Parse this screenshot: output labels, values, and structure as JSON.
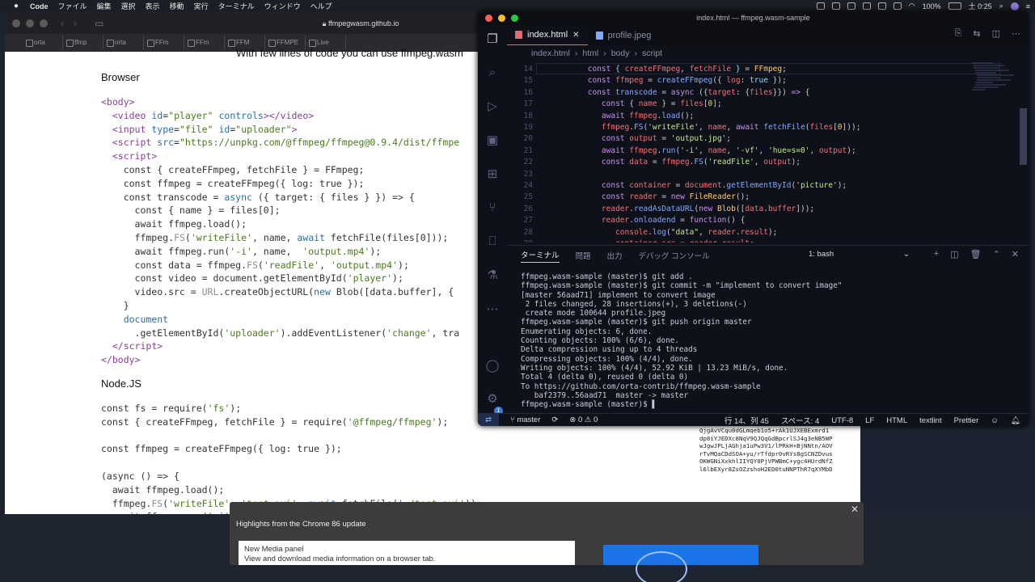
{
  "menubar": {
    "app": "Code",
    "items": [
      "ファイル",
      "編集",
      "選択",
      "表示",
      "移動",
      "実行",
      "ターミナル",
      "ウィンドウ",
      "ヘルプ"
    ],
    "battery": "100%",
    "clock": "土 0:25"
  },
  "chrome": {
    "url": "ffmpegwasm.github.io",
    "tabs": [
      "orta",
      "ffmp",
      "orta",
      "FFm",
      "FFm",
      "FFM",
      "FFMPE",
      "Live"
    ],
    "partial_heading": "With few lines of code you can use ffmpeg.wasm",
    "browser_heading": "Browser",
    "nodejs_heading": "Node.JS"
  },
  "vscode": {
    "title": "index.html — ffmpeg.wasm-sample",
    "tabs": [
      {
        "label": "index.html",
        "close": "✕"
      },
      {
        "label": "profile.jpeg"
      }
    ],
    "breadcrumbs": [
      "index.html",
      "html",
      "body",
      "script"
    ],
    "line_numbers": "14\n15\n16\n17\n18\n19\n20\n21\n22\n23\n24\n25\n26\n27\n28\n29",
    "panel_tabs": [
      "ターミナル",
      "問題",
      "出力",
      "デバッグ コンソール"
    ],
    "terminal_select": "1: bash",
    "terminal": "ffmpeg.wasm-sample (master)$ git add .\nffmpeg.wasm-sample (master)$ git commit -m \"implement to convert image\"\n[master 56aad71] implement to convert image\n 2 files changed, 28 insertions(+), 3 deletions(-)\n create mode 100644 profile.jpeg\nffmpeg.wasm-sample (master)$ git push origin master\nEnumerating objects: 6, done.\nCounting objects: 100% (6/6), done.\nDelta compression using up to 4 threads\nCompressing objects: 100% (4/4), done.\nWriting objects: 100% (4/4), 52.92 KiB | 13.23 MiB/s, done.\nTotal 4 (delta 0), reused 0 (delta 0)\nTo https://github.com/orta-contrib/ffmpeg.wasm-sample\n   baf2379..56aad71  master -> master\nffmpeg.wasm-sample (master)$ ▌",
    "status": {
      "branch": "master",
      "problems": "⊗ 0 ⚠ 0",
      "position": "行 14、列 45",
      "spaces": "スペース: 4",
      "encoding": "UTF-8",
      "eol": "LF",
      "language": "HTML",
      "lint": "textlint",
      "formatter": "Prettier",
      "badge": "1"
    }
  },
  "rightpage": {
    "hash": "QjgAvVCqu0dGLmqeb1o5+rAk1UJXEBExmrd1\ndp8iYJEDXc8NqV9QJQqGdBpcrlSJ4g3eNB5WP\nwJgwJPLjAGhja1uPw3V1/lPRkH+BjNNtn/AOV\nrTvMQaCDdSOA+yu/rTfdpr0vRYs8gSCNZDvus\nOKWGNiXxkhlIIYQY0PjVPWBmC+ygc4HUrdNfZ\nl6lbEXyr8ZsOZzshoH2ED0tuNNPThR7qXYMbD"
  },
  "notification": {
    "title": "Highlights from the Chrome 86 update",
    "card_title": "New Media panel",
    "card_body": "View and download media information on a browser tab.",
    "close": "✕"
  }
}
